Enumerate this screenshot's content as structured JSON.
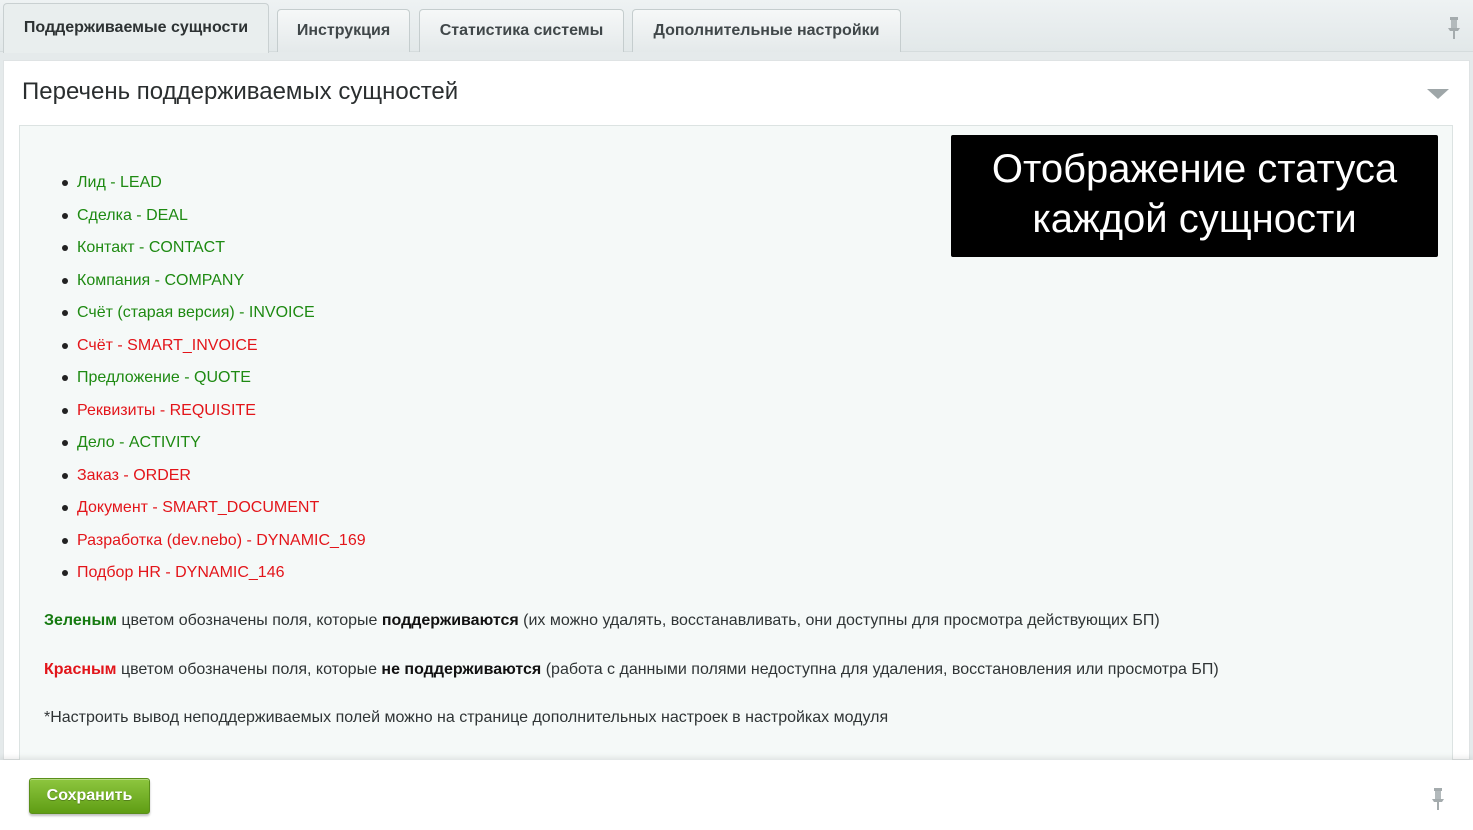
{
  "tabs": [
    {
      "label": "Поддерживаемые сущности",
      "active": true
    },
    {
      "label": "Инструкция",
      "active": false
    },
    {
      "label": "Статистика системы",
      "active": false
    },
    {
      "label": "Дополнительные настройки",
      "active": false
    }
  ],
  "panel": {
    "title": "Перечень поддерживаемых сущностей"
  },
  "entities": [
    {
      "label": "Лид - LEAD",
      "status": "supported"
    },
    {
      "label": "Сделка - DEAL",
      "status": "supported"
    },
    {
      "label": "Контакт - CONTACT",
      "status": "supported"
    },
    {
      "label": "Компания - COMPANY",
      "status": "supported"
    },
    {
      "label": "Счёт (старая версия) - INVOICE",
      "status": "supported"
    },
    {
      "label": "Счёт - SMART_INVOICE",
      "status": "unsupported"
    },
    {
      "label": "Предложение - QUOTE",
      "status": "supported"
    },
    {
      "label": "Реквизиты - REQUISITE",
      "status": "unsupported"
    },
    {
      "label": "Дело - ACTIVITY",
      "status": "supported"
    },
    {
      "label": "Заказ - ORDER",
      "status": "unsupported"
    },
    {
      "label": "Документ - SMART_DOCUMENT",
      "status": "unsupported"
    },
    {
      "label": "Разработка (dev.nebo) - DYNAMIC_169",
      "status": "unsupported"
    },
    {
      "label": "Подбор HR - DYNAMIC_146",
      "status": "unsupported"
    }
  ],
  "notes": {
    "green": {
      "color_word": "Зеленым",
      "middle": " цветом обозначены поля, которые ",
      "emphasis": "поддерживаются",
      "tail": " (их можно удалять, восстанавливать, они доступны для просмотра действующих БП)"
    },
    "red": {
      "color_word": "Красным",
      "middle": " цветом обозначены поля, которые ",
      "emphasis": "не поддерживаются",
      "tail": " (работа с данными полями недоступна для удаления, восстановления или просмотра БП)"
    },
    "footnote": "*Настроить вывод неподдерживаемых полей можно на странице дополнительных настроек в настройках модуля"
  },
  "overlay": {
    "line1": "Отображение статуса",
    "line2": "каждой сущности"
  },
  "footer": {
    "save_label": "Сохранить"
  },
  "colors": {
    "supported": "#1e8a12",
    "unsupported": "#e3151a",
    "save_button": "#6fae1f"
  },
  "icons": {
    "pin": "pin-icon",
    "collapse": "chevron-down-icon"
  }
}
